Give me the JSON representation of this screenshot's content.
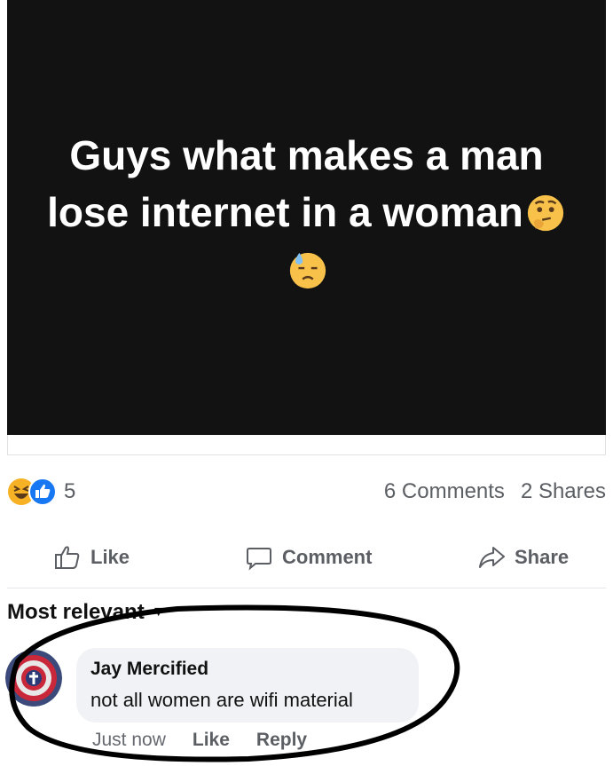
{
  "post": {
    "text": "Guys what makes a man lose internet in a woman",
    "emoji_1": "thinking-face",
    "emoji_2": "downcast-face-with-sweat"
  },
  "reactions": {
    "count": "5",
    "icons": [
      "haha-reaction",
      "like-reaction"
    ],
    "colors": {
      "like": "#1877f2",
      "haha": "#f7b125"
    }
  },
  "stats": {
    "comments": "6 Comments",
    "shares": "2 Shares"
  },
  "actions": {
    "like": "Like",
    "comment": "Comment",
    "share": "Share"
  },
  "comments_section": {
    "sort_label": "Most relevant"
  },
  "comment": {
    "author": "Jay Mercified",
    "text": "not all women are wifi material",
    "time": "Just now",
    "like": "Like",
    "reply": "Reply"
  },
  "annotation": {
    "shape": "hand-drawn black ellipse around comment",
    "color": "#000000"
  }
}
